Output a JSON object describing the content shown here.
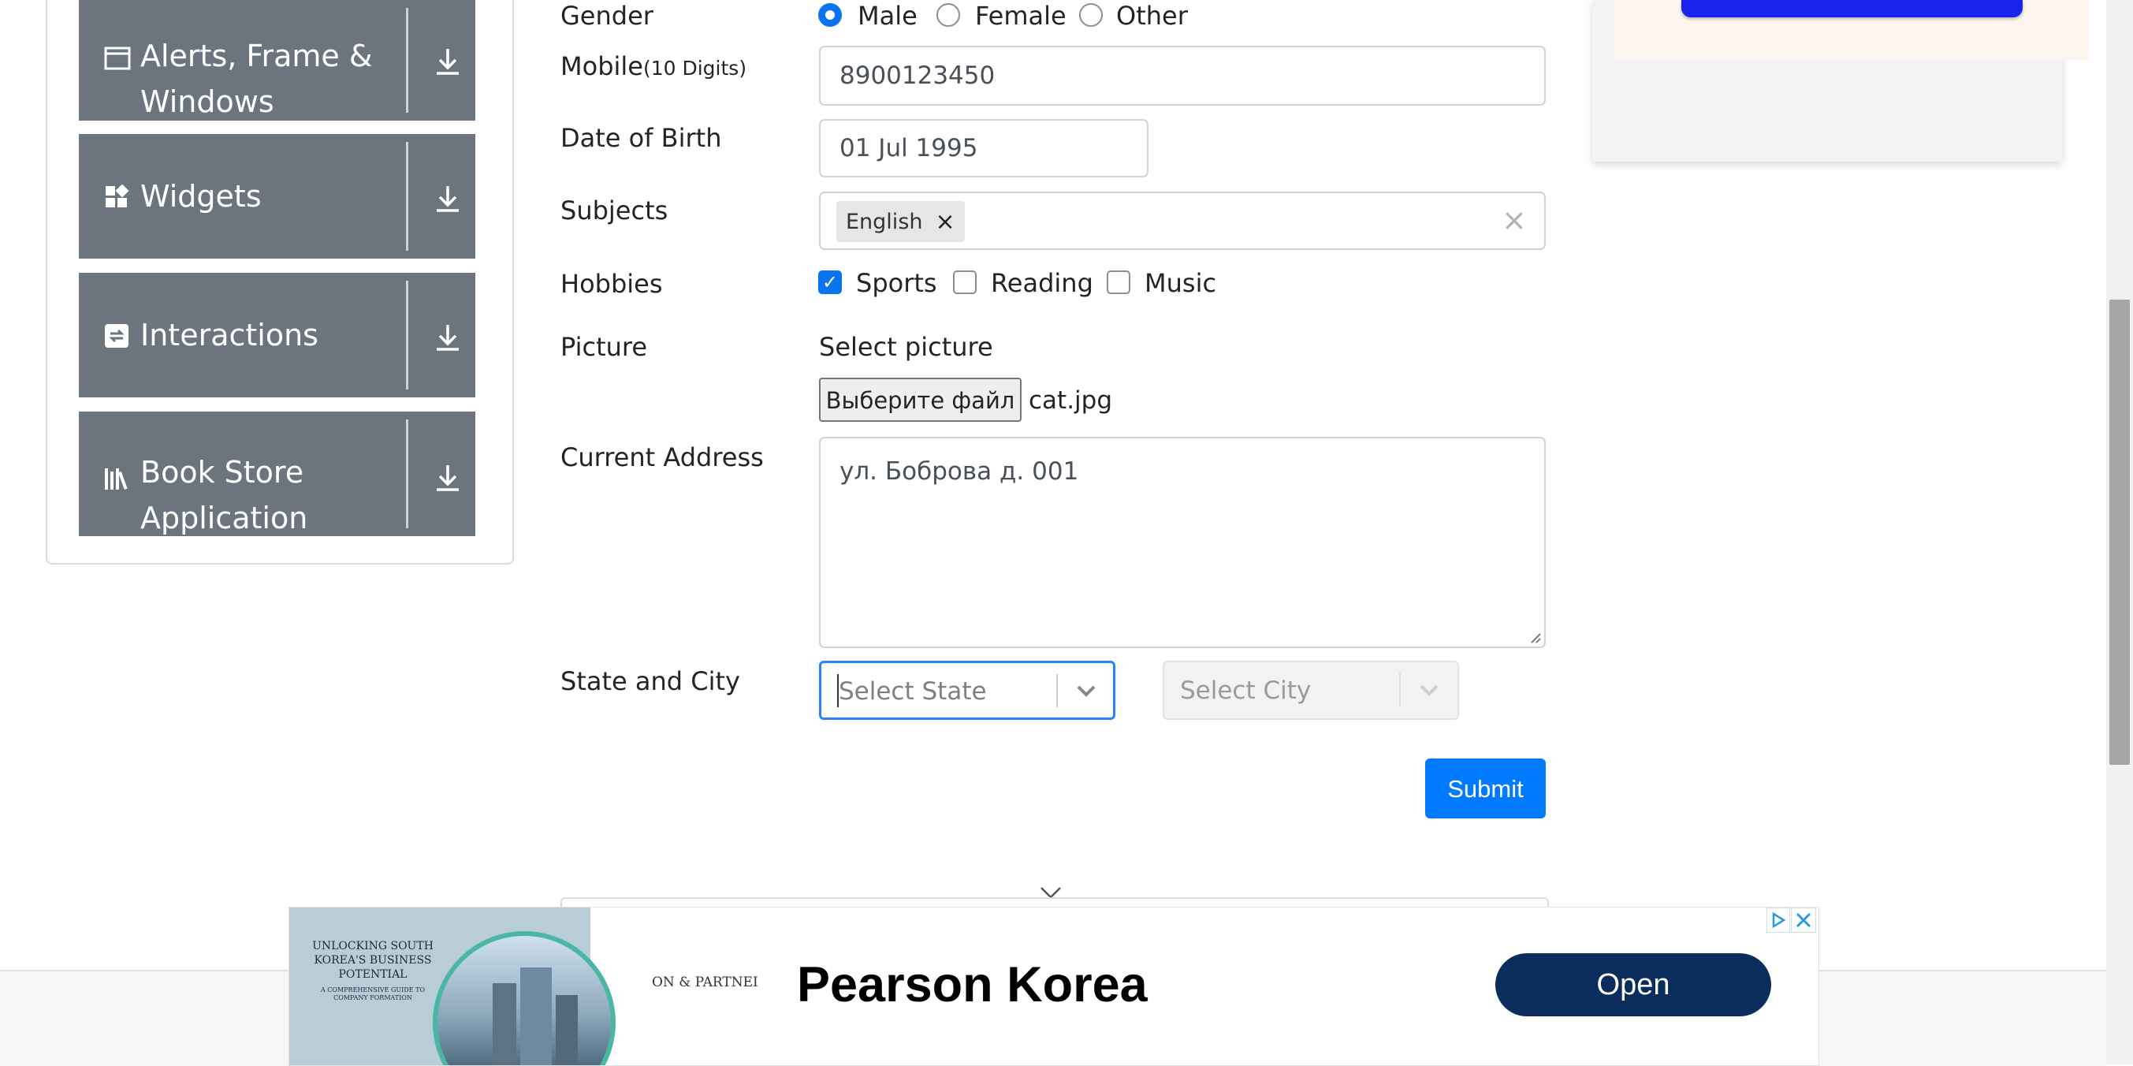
{
  "sidebar": {
    "groups": [
      {
        "label": "Alerts, Frame & Windows",
        "icon": "window-icon"
      },
      {
        "label": "Widgets",
        "icon": "widgets-icon"
      },
      {
        "label": "Interactions",
        "icon": "interactions-icon"
      },
      {
        "label": "Book Store Application",
        "icon": "books-icon"
      }
    ]
  },
  "form": {
    "gender": {
      "label": "Gender",
      "options": [
        "Male",
        "Female",
        "Other"
      ],
      "selected": "Male"
    },
    "mobile": {
      "label": "Mobile",
      "hint": "(10 Digits)",
      "value": "8900123450"
    },
    "dob": {
      "label": "Date of Birth",
      "value": "01 Jul 1995"
    },
    "subjects": {
      "label": "Subjects",
      "tags": [
        "English"
      ],
      "remove_glyph": "×",
      "clear_glyph": "×"
    },
    "hobbies": {
      "label": "Hobbies",
      "options": [
        "Sports",
        "Reading",
        "Music"
      ],
      "checked": [
        "Sports"
      ]
    },
    "picture": {
      "label": "Picture",
      "caption": "Select picture",
      "button": "Выберите файл",
      "file": "cat.jpg"
    },
    "address": {
      "label": "Current Address",
      "value": "ул. Боброва д. 001"
    },
    "state_city": {
      "label": "State and City",
      "state_placeholder": "Select State",
      "city_placeholder": "Select City"
    },
    "submit": "Submit"
  },
  "ad": {
    "book_title": "UNLOCKING SOUTH KOREA'S BUSINESS POTENTIAL",
    "book_subtitle": "A COMPREHENSIVE GUIDE TO COMPANY FORMATION",
    "partner_text": "ON & PARTNEI",
    "headline": "Pearson Korea",
    "cta": "Open"
  },
  "colors": {
    "accent": "#007bff",
    "sidebar": "#6c757d",
    "ad_cta": "#0b2d5e"
  }
}
